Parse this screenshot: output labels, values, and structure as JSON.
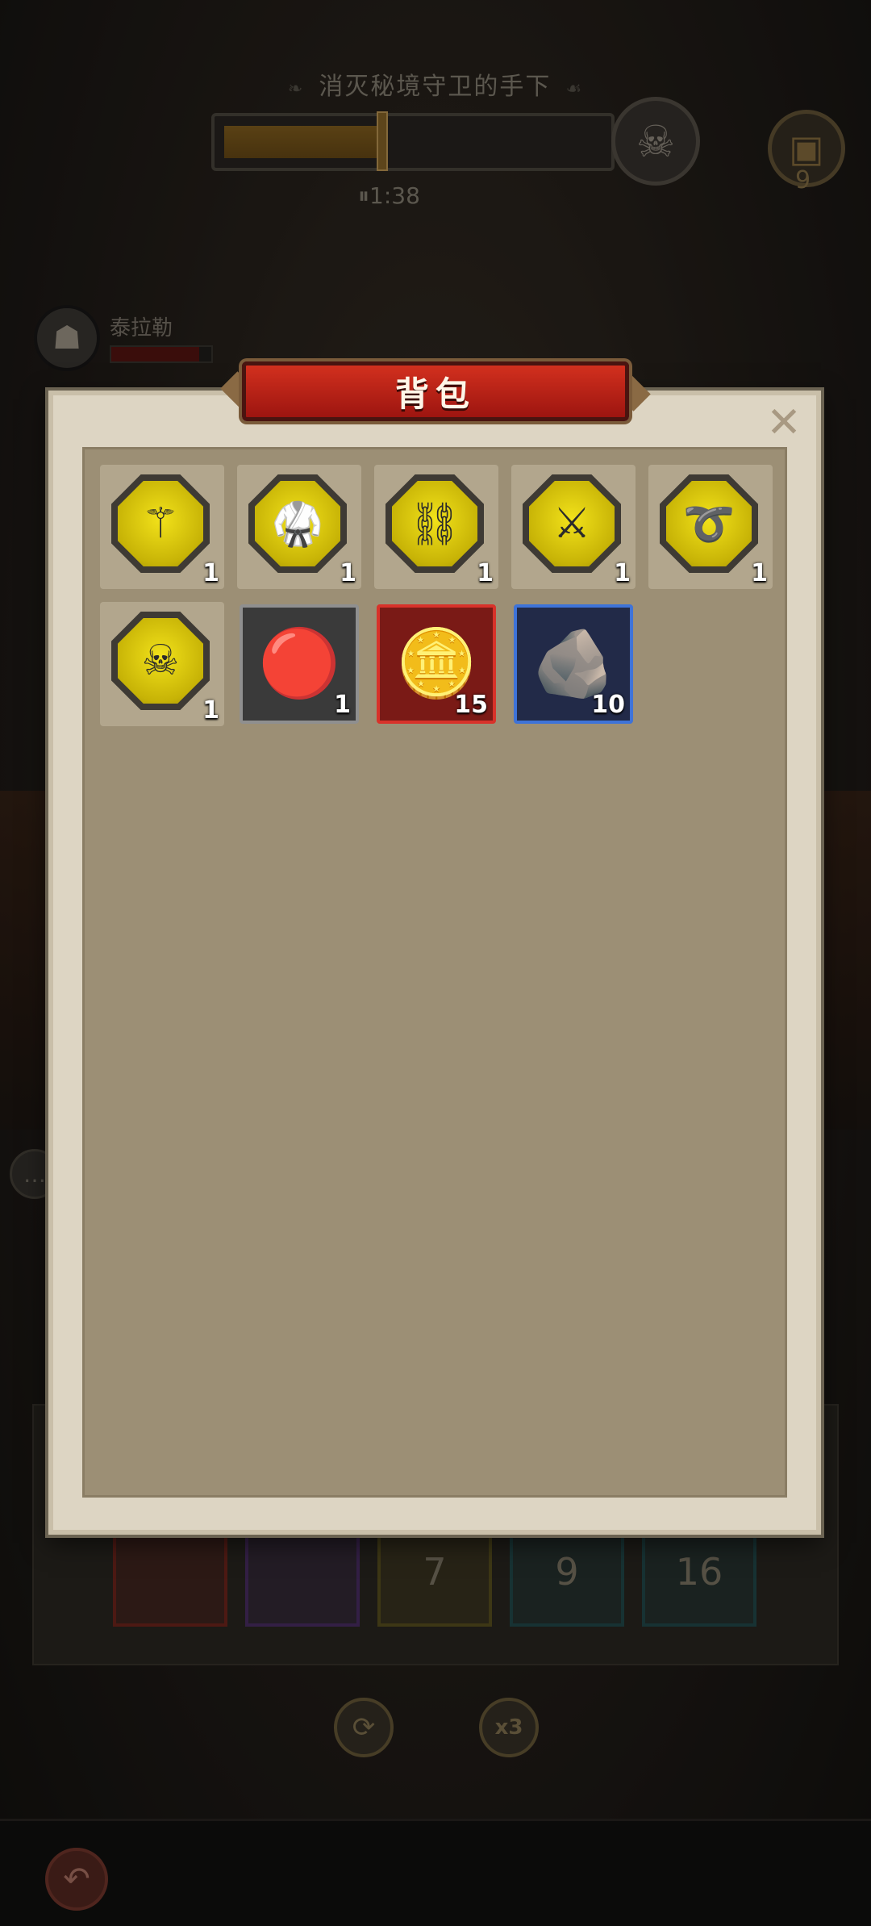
{
  "hud": {
    "quest_title": "消灭秘境守卫的手下",
    "progress": 0.42,
    "timer": "1:38",
    "pause_icon": "pause-icon",
    "boss_icon": "skull-boss-icon",
    "chest_count": "9"
  },
  "hero": {
    "name": "泰拉勒",
    "hp_fraction": 0.88
  },
  "panel": {
    "title": "背包",
    "close_label": "✕"
  },
  "inventory": [
    {
      "icon": "flame-staff-icon",
      "glyph": "⚚",
      "count": "1",
      "kind": "equip"
    },
    {
      "icon": "armor-robe-icon",
      "glyph": "🥋",
      "count": "1",
      "kind": "equip"
    },
    {
      "icon": "gem-belt-icon",
      "glyph": "⛓",
      "count": "1",
      "kind": "equip"
    },
    {
      "icon": "cross-weapons-icon",
      "glyph": "⚔",
      "count": "1",
      "kind": "equip"
    },
    {
      "icon": "necklace-icon",
      "glyph": "➰",
      "count": "1",
      "kind": "equip"
    },
    {
      "icon": "skull-amulet-icon",
      "glyph": "☠",
      "count": "1",
      "kind": "equip"
    },
    {
      "icon": "red-gem-icon",
      "glyph": "🔴",
      "count": "1",
      "kind": "gray"
    },
    {
      "icon": "skull-coin-icon",
      "glyph": "🪙",
      "count": "15",
      "kind": "red"
    },
    {
      "icon": "ore-pile-icon",
      "glyph": "🪨",
      "count": "10",
      "kind": "blue"
    }
  ],
  "skills": [
    {
      "icon": "flame-claw-icon",
      "label": "",
      "color": "#b5271b"
    },
    {
      "icon": "fist-icon",
      "label": "",
      "color": "#6e3aa6"
    },
    {
      "icon": "spike-icon",
      "label": "7",
      "color": "#8a7a20"
    },
    {
      "icon": "frost-icon",
      "label": "9",
      "color": "#1f6e74"
    },
    {
      "icon": "wave-icon",
      "label": "16",
      "color": "#1f6e74"
    }
  ],
  "controls": {
    "cycle_icon": "refresh-icon",
    "speed_label": "x3",
    "back_icon": "back-arrow-icon"
  }
}
